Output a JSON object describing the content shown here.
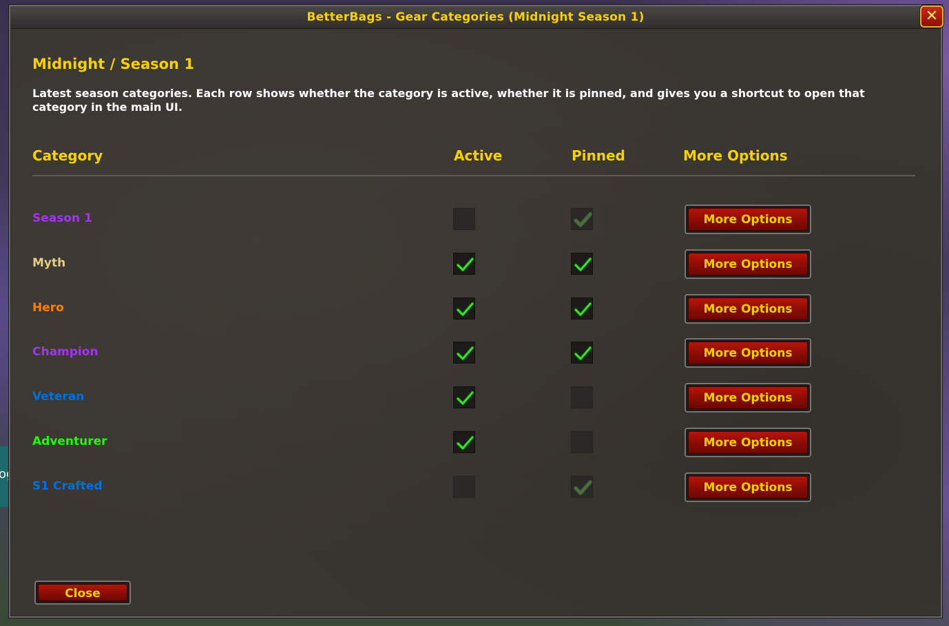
{
  "window": {
    "title": "BetterBags - Gear Categories (Midnight Season 1)",
    "close_glyph": "✕"
  },
  "heading": "Midnight / Season 1",
  "description": "Latest season categories. Each row shows whether the category is active, whether it is pinned, and gives you a shortcut to open that category in the main UI.",
  "columns": {
    "category": "Category",
    "active": "Active",
    "pinned": "Pinned",
    "more_options": "More Options"
  },
  "rows": [
    {
      "label": "Season 1",
      "color": "#a335ee",
      "active": false,
      "pinned": true,
      "pinned_dim": true,
      "button": "More Options"
    },
    {
      "label": "Myth",
      "color": "#e6cc80",
      "active": true,
      "pinned": true,
      "button": "More Options"
    },
    {
      "label": "Hero",
      "color": "#ff8000",
      "active": true,
      "pinned": true,
      "button": "More Options"
    },
    {
      "label": "Champion",
      "color": "#a335ee",
      "active": true,
      "pinned": true,
      "button": "More Options"
    },
    {
      "label": "Veteran",
      "color": "#0070dd",
      "active": true,
      "pinned": false,
      "button": "More Options"
    },
    {
      "label": "Adventurer",
      "color": "#1eff00",
      "active": true,
      "pinned": false,
      "button": "More Options"
    },
    {
      "label": "S1 Crafted",
      "color": "#0070dd",
      "active": false,
      "pinned": true,
      "pinned_dim": true,
      "button": "More Options"
    }
  ],
  "footer": {
    "close_label": "Close"
  }
}
